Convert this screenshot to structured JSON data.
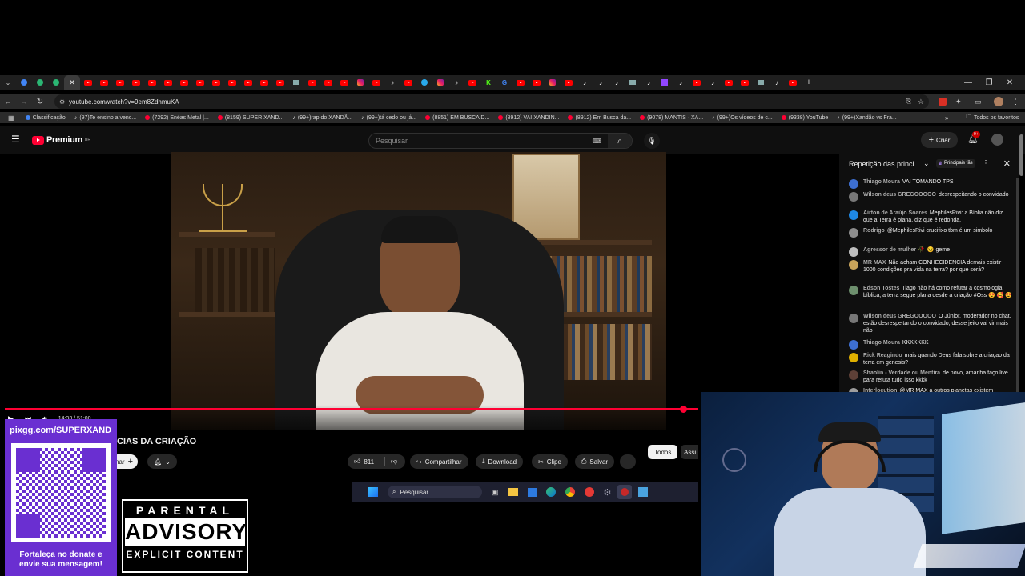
{
  "browser": {
    "url": "youtube.com/watch?v=9em8ZdhmuKA",
    "bookmarks": [
      {
        "label": "Classificação"
      },
      {
        "label": "(97)Te ensino a venc..."
      },
      {
        "label": "(7292) Enéas Metal |..."
      },
      {
        "label": "(8159) SUPER XAND..."
      },
      {
        "label": "(99+)rap do XANDÃ..."
      },
      {
        "label": "(99+)tá cedo ou já..."
      },
      {
        "label": "(8851) EM BUSCA D..."
      },
      {
        "label": "(8912) VAI XANDIN..."
      },
      {
        "label": "(8912) Em Busca da..."
      },
      {
        "label": "(9078) MANTIS · XA..."
      },
      {
        "label": "(99+)Os vídeos de c..."
      },
      {
        "label": "(9338) YouTube"
      },
      {
        "label": "(99+)Xandão vs Fra..."
      }
    ],
    "all_bookmarks": "Todos os favoritos"
  },
  "youtube": {
    "logo": "Premium",
    "region": "BR",
    "search_placeholder": "Pesquisar",
    "create_label": "Criar",
    "notifications_badge": "9+",
    "video_title_partial": "CIAS DA CRIAÇÃO",
    "time_display": "14:33 / 51:00",
    "like_count": "811",
    "share_label": "Compartilhar",
    "download_label": "Download",
    "clip_label": "Clipe",
    "save_label": "Salvar",
    "subscribe_partial": "nar",
    "filter_all": "Todos",
    "filter_partial": "Assi",
    "progress": 0.98
  },
  "chat": {
    "title": "Repetição das princi...",
    "fans_label": "Principais fãs",
    "messages": [
      {
        "author": "Thiago Moura",
        "text": "VAI TOMANDO TPS",
        "color": "#3d6fd1"
      },
      {
        "author": "Wilson deus GREGOOOOO",
        "text": "desrespeitando o convidado",
        "color": "#777777"
      },
      {
        "author": "Airton de Araújo Soares",
        "text": "MephilesRivi: a Bíblia não diz que a Terra é plana, diz que é redonda.",
        "color": "#1e88e5"
      },
      {
        "author": "Rodrigo",
        "text": "@MephilesRivi crucifixo tbm é um simbolo",
        "color": "#8d8d8d"
      },
      {
        "author": "Agressor de mulher 🥀",
        "text": "😏 geme",
        "color": "#bdbdbd"
      },
      {
        "author": "MR MAX",
        "text": "Não acham CONHECIDENCIA demais existir 1000 condições pra vida na terra? por que será?",
        "color": "#c7a35a"
      },
      {
        "author": "Edson Tostes",
        "text": "Tiago não há como refutar a cosmologia bíblica, a terra segue plana desde a criação #Oss 😍 🥰 😍",
        "color": "#6d8f6d"
      },
      {
        "author": "Wilson deus GREGOOOOO",
        "text": "O Júnior, moderador no chat, estão desrespeitando o convidado, desse jeito vai vir mais não",
        "color": "#777777"
      },
      {
        "author": "Thiago Moura",
        "text": "KKKKKKK",
        "color": "#3d6fd1"
      },
      {
        "author": "Rick Reagindo",
        "text": "mais quando Deus fala sobre a criaçao da terra em genesis?",
        "color": "#e0b000"
      },
      {
        "author": "Shaolin - Verdade ou Mentira",
        "text": "de novo, amanha faço live para refuta tudo isso kkkk",
        "color": "#5d4037"
      },
      {
        "author": "Interlocution",
        "text": "@MR MAX a outros planetas existem",
        "color": "#9e9e9e"
      }
    ]
  },
  "taskbar": {
    "search_placeholder": "Pesquisar"
  },
  "overlay": {
    "pix_url": "pixgg.com/SUPERXAND",
    "donate_text": "Fortaleça no donate e envie sua mensagem!",
    "advisory_line1": "PARENTAL",
    "advisory_line2": "ADVISORY",
    "advisory_line3": "EXPLICIT CONTENT"
  },
  "colors": {
    "youtube_red": "#ff0033",
    "overlay_purple": "#6a2fd1",
    "dark_bg": "#0f0f0f"
  }
}
